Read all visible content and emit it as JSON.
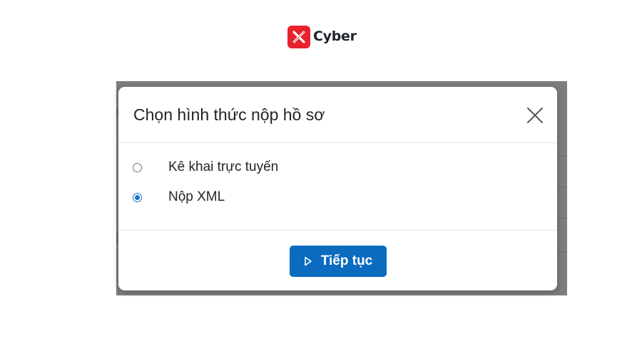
{
  "brand": {
    "name": "Cyber",
    "logo_color": "#e8212b"
  },
  "modal": {
    "title": "Chọn hình thức nộp hồ sơ",
    "close_icon": "close-icon",
    "options": [
      {
        "label": "Kê khai trực tuyến",
        "checked": false
      },
      {
        "label": "Nộp XML",
        "checked": true
      }
    ],
    "continue_label": "Tiếp tục",
    "continue_icon": "play-outline-icon",
    "accent_color": "#0a6bbf"
  }
}
